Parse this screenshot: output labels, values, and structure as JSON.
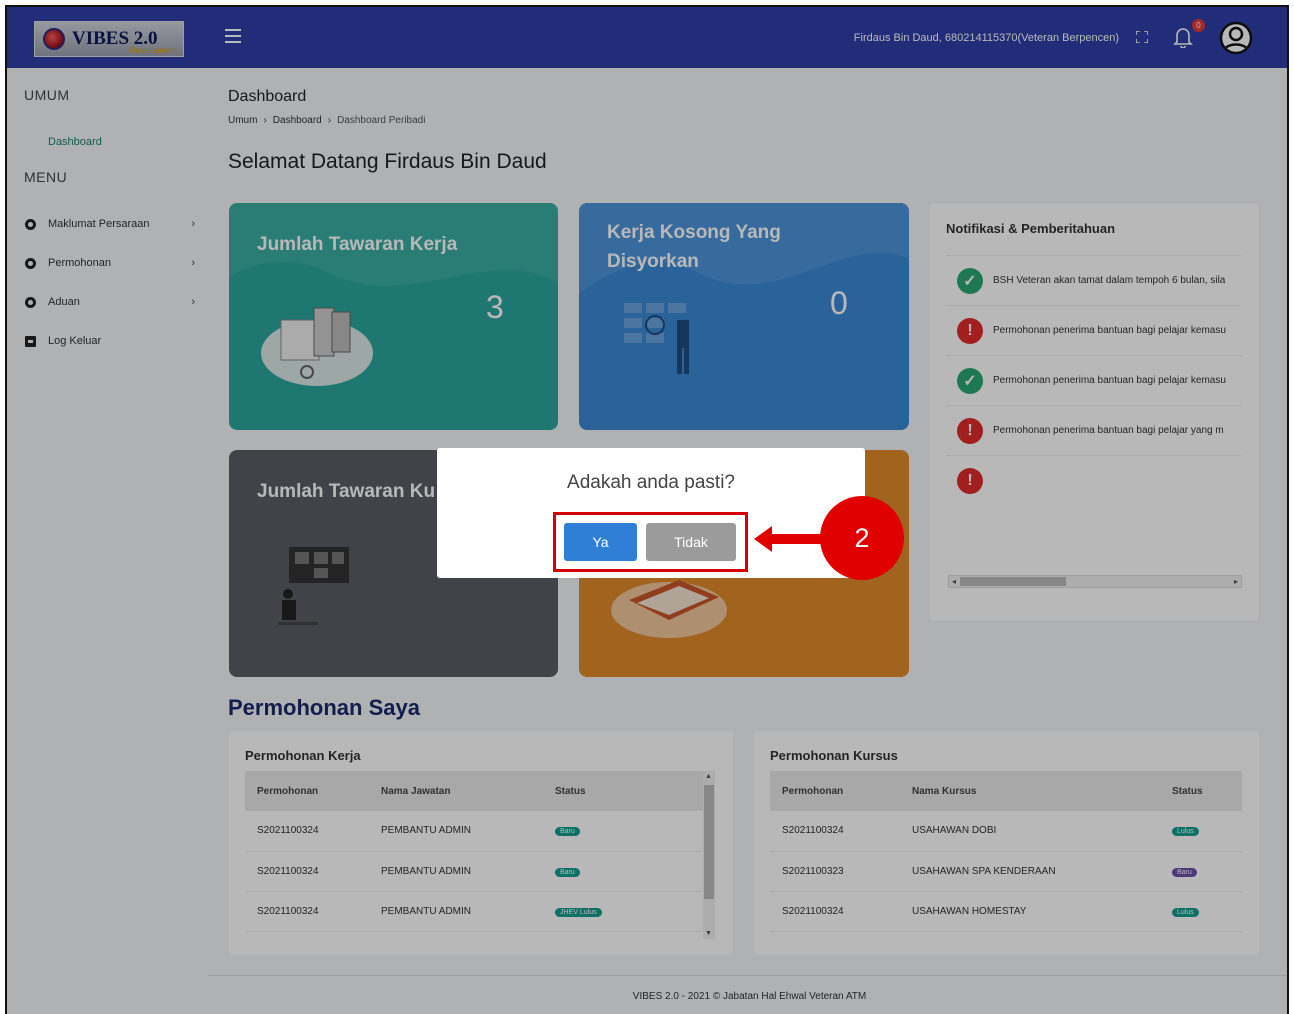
{
  "header": {
    "logo_text": "VIBES 2.0",
    "logo_sub": "Development",
    "user_info": "Firdaus Bin Daud, 680214115370(Veteran Berpencen)",
    "notif_count": "0"
  },
  "sidebar": {
    "section_umum": "UMUM",
    "section_menu": "MENU",
    "items": [
      {
        "label": "Dashboard"
      },
      {
        "label": "Maklumat Persaraan"
      },
      {
        "label": "Permohonan"
      },
      {
        "label": "Aduan"
      },
      {
        "label": "Log Keluar"
      }
    ]
  },
  "main": {
    "page_title": "Dashboard",
    "breadcrumb": [
      "Umum",
      "Dashboard",
      "Dashboard Peribadi"
    ],
    "welcome": "Selamat Datang Firdaus Bin Daud",
    "cards": [
      {
        "title": "Jumlah Tawaran Kerja",
        "count": "3",
        "color": "#2aa69b"
      },
      {
        "title": "Kerja Kosong Yang Disyorkan",
        "count": "0",
        "color": "#3a8ad6"
      },
      {
        "title": "Jumlah Tawaran Ku",
        "count": "",
        "color": "#5a5e66"
      },
      {
        "title": "",
        "count": "",
        "color": "#e08a2a"
      }
    ],
    "notifications": {
      "title": "Notifikasi & Pemberitahuan",
      "items": [
        {
          "type": "ok",
          "text": "BSH Veteran akan tamat dalam tempoh 6 bulan, sila"
        },
        {
          "type": "err",
          "text": "Permohonan penerima bantuan bagi pelajar kemasu"
        },
        {
          "type": "ok",
          "text": "Permohonan penerima bantuan bagi pelajar kemasu"
        },
        {
          "type": "err",
          "text": "Permohonan penerima bantuan bagi pelajar yang m"
        },
        {
          "type": "err",
          "text": ""
        }
      ]
    },
    "section_title": "Permohonan Saya",
    "kerja": {
      "title": "Permohonan Kerja",
      "headers": [
        "Permohonan",
        "Nama Jawatan",
        "Status"
      ],
      "rows": [
        [
          "S2021100324",
          "PEMBANTU ADMIN",
          "Baru"
        ],
        [
          "S2021100324",
          "PEMBANTU ADMIN",
          "Baru"
        ],
        [
          "S2021100324",
          "PEMBANTU ADMIN",
          "JHEV Lulus"
        ]
      ]
    },
    "kursus": {
      "title": "Permohonan Kursus",
      "headers": [
        "Permohonan",
        "Nama Kursus",
        "Status"
      ],
      "rows": [
        [
          "S2021100324",
          "USAHAWAN DOBI",
          "Lulus"
        ],
        [
          "S2021100323",
          "USAHAWAN SPA KENDERAAN",
          "Baru"
        ],
        [
          "S2021100324",
          "USAHAWAN HOMESTAY",
          "Lulus"
        ]
      ]
    },
    "footer": "VIBES 2.0 - 2021 © Jabatan Hal Ehwal Veteran ATM"
  },
  "modal": {
    "title": "Adakah anda pasti?",
    "yes": "Ya",
    "no": "Tidak"
  },
  "annotation": {
    "step": "2"
  }
}
